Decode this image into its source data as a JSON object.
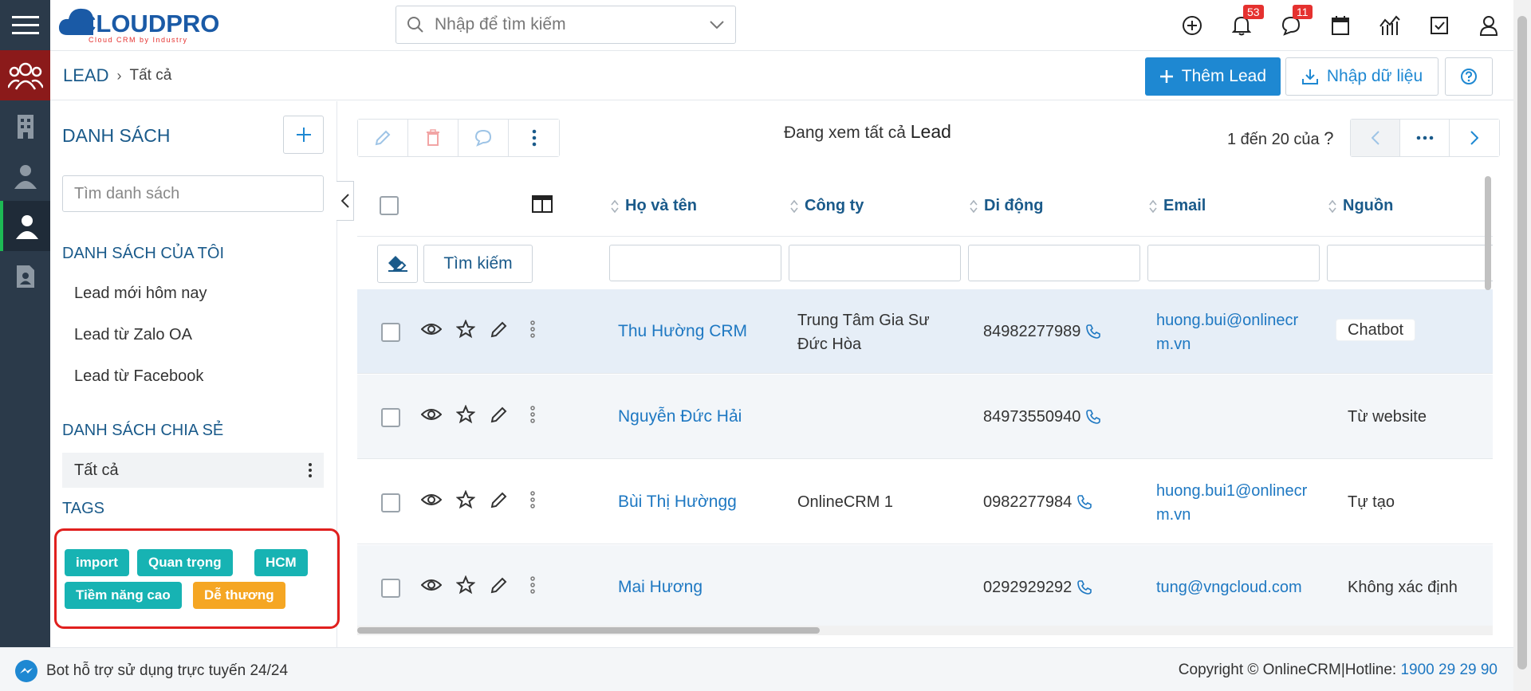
{
  "app": {
    "logo_text": "CLOUDPRO",
    "logo_sub": "Cloud CRM by Industry"
  },
  "header": {
    "search_placeholder": "Nhập để tìm kiếm",
    "notifications_count": "53",
    "messages_count": "11"
  },
  "breadcrumb": {
    "module": "LEAD",
    "current": "Tất cả"
  },
  "actions": {
    "add_label": "Thêm Lead",
    "import_label": "Nhập dữ liệu"
  },
  "sidebar": {
    "title": "DANH SÁCH",
    "search_placeholder": "Tìm danh sách",
    "my_lists_title": "DANH SÁCH CỦA TÔI",
    "my_lists": [
      "Lead mới hôm nay",
      "Lead từ Zalo OA",
      "Lead từ Facebook"
    ],
    "shared_title": "DANH SÁCH CHIA SẺ",
    "shared_item": "Tất cả",
    "tags_title": "TAGS",
    "tags": [
      {
        "label": "import",
        "color": "#17b3b3"
      },
      {
        "label": "Quan trọng",
        "color": "#17b3b3"
      },
      {
        "label": "HCM",
        "color": "#17b3b3"
      },
      {
        "label": "Tiềm năng cao",
        "color": "#17b3b3"
      },
      {
        "label": "Dễ thương",
        "color": "#f5a623"
      }
    ]
  },
  "main": {
    "viewing_prefix": "Đang xem tất cả",
    "viewing_module": "Lead",
    "pager_text": "1 đến 20 của",
    "pager_unknown": "?",
    "find_label": "Tìm kiếm",
    "columns": [
      "Họ và tên",
      "Công ty",
      "Di động",
      "Email",
      "Nguồn"
    ],
    "rows": [
      {
        "name": "Thu Hường CRM",
        "company": "Trung Tâm Gia Sư Đức Hòa",
        "mobile": "84982277989",
        "email": "huong.bui@onlinecrm.vn",
        "source": "Chatbot"
      },
      {
        "name": "Nguyễn Đức Hải",
        "company": "",
        "mobile": "84973550940",
        "email": "",
        "source": "Từ website"
      },
      {
        "name": "Bùi Thị Hườngg",
        "company": "OnlineCRM 1",
        "mobile": "0982277984",
        "email": "huong.bui1@onlinecrm.vn",
        "source": "Tự tạo"
      },
      {
        "name": "Mai Hương",
        "company": "",
        "mobile": "0292929292",
        "email": "tung@vngcloud.com",
        "source": "Không xác định"
      }
    ]
  },
  "footer": {
    "bot_text": "Bot hỗ trợ sử dụng trực tuyến 24/24",
    "copyright": "Copyright © OnlineCRM|Hotline:",
    "hotline": "1900 29 29 90"
  },
  "colors": {
    "primary": "#1e88d2",
    "link": "#1e78c2",
    "heading": "#1a5a8a",
    "rail": "#2b3a4a",
    "badge": "#e5312f",
    "highlight_border": "#e0201e"
  }
}
